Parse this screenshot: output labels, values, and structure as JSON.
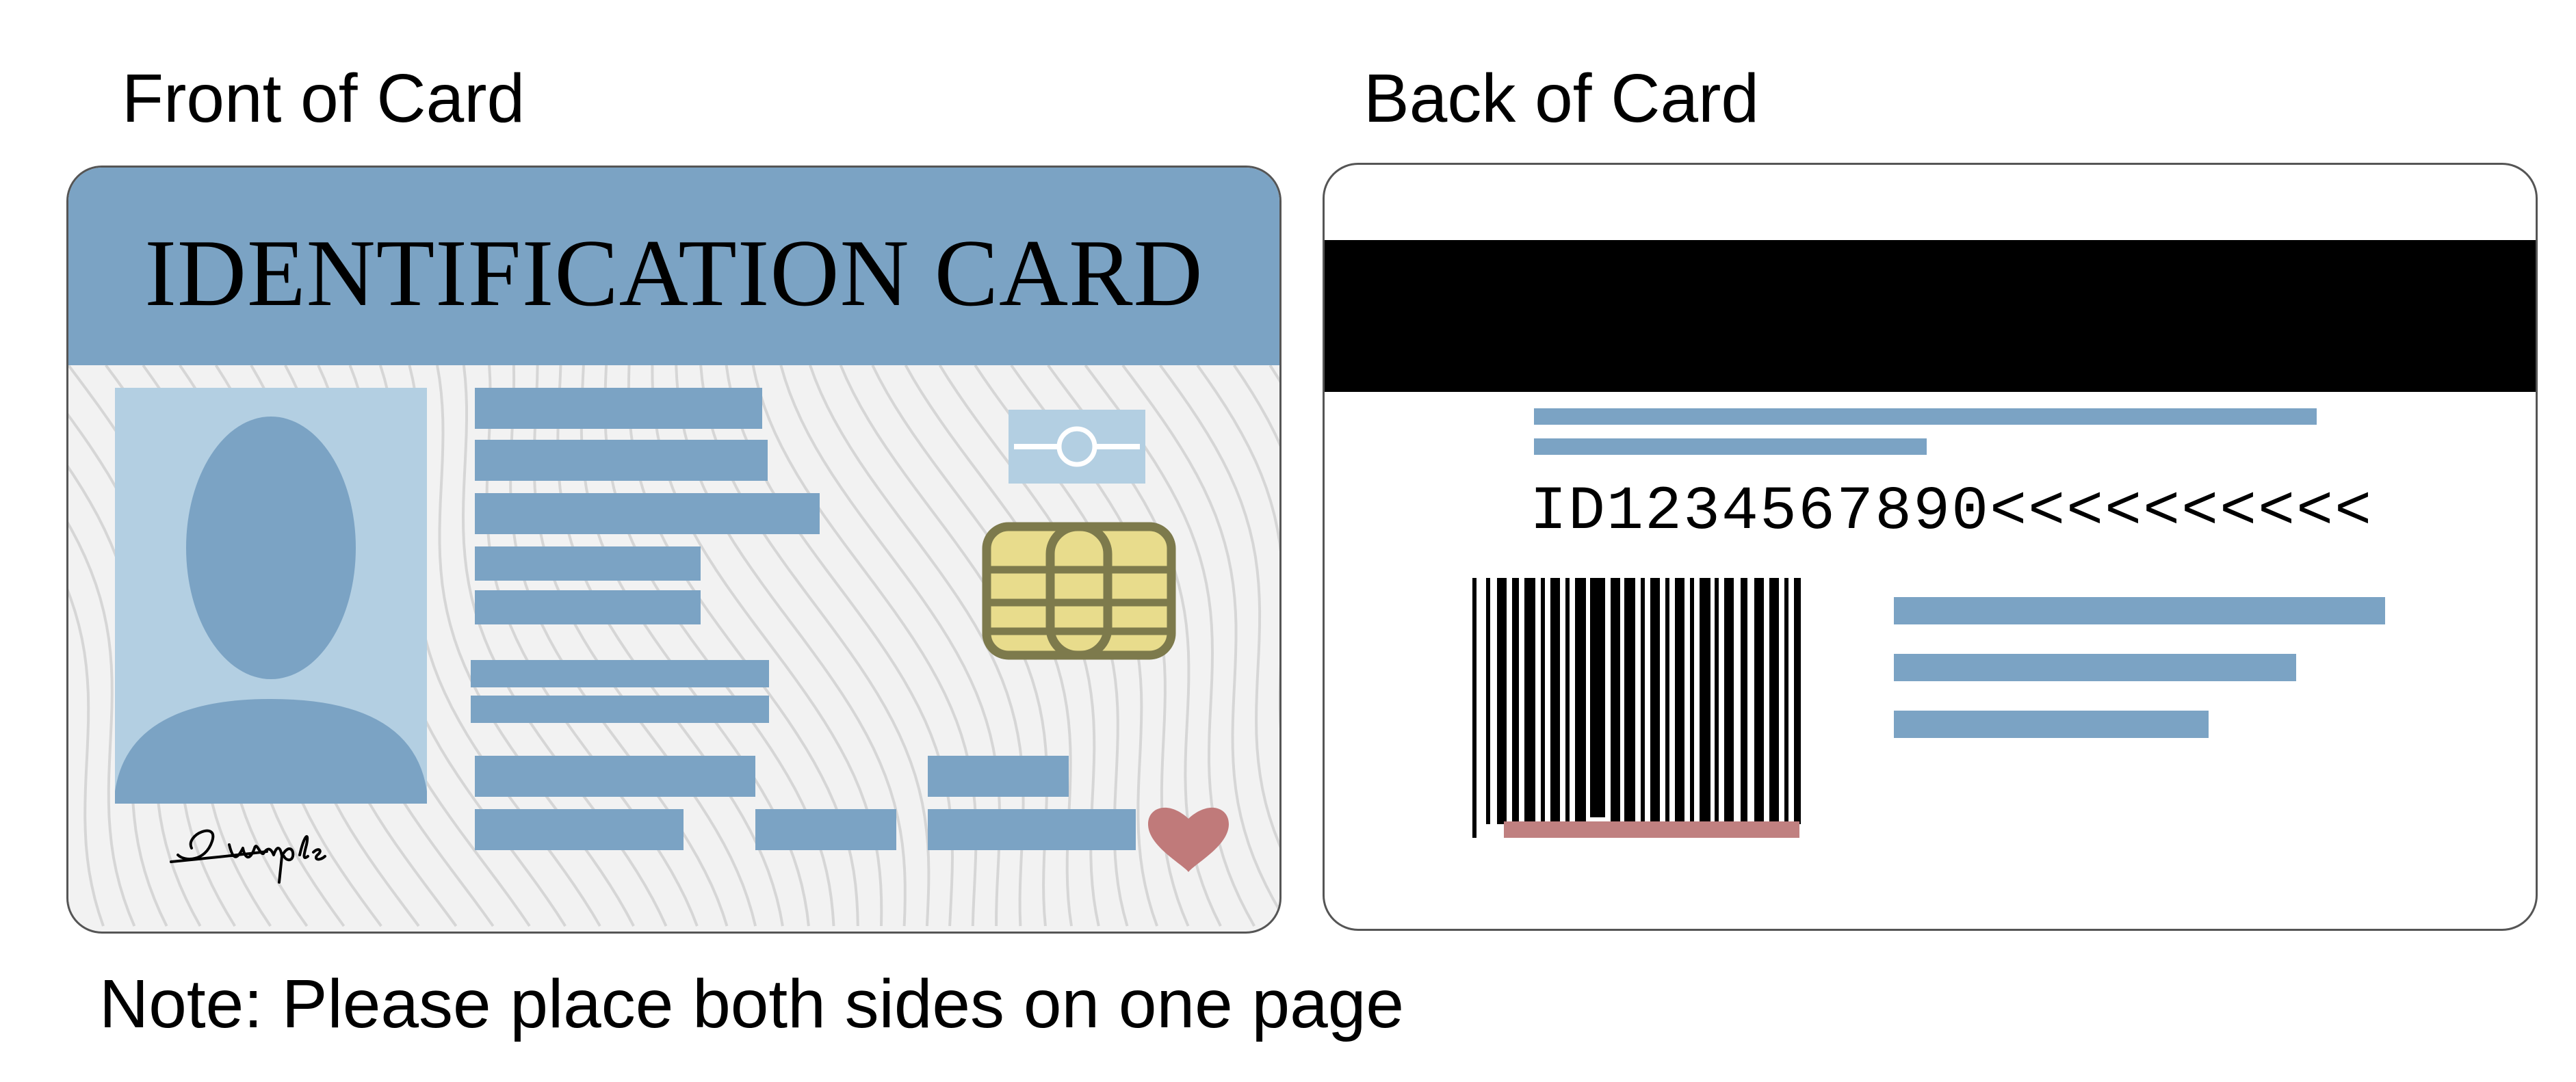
{
  "headings": {
    "front": "Front of Card",
    "back": "Back of Card",
    "note": "Note: Please place both sides on one page"
  },
  "front_card": {
    "title": "IDENTIFICATION CARD",
    "signature": "Sample",
    "icons": [
      "portrait-silhouette-icon",
      "hologram-icon",
      "chip-icon",
      "heart-icon"
    ]
  },
  "back_card": {
    "mrz_line": "ID1234567890<<<<<<<<<<",
    "icons": [
      "barcode-icon"
    ]
  },
  "colors": {
    "banner_blue": "#7ba3c4",
    "photo_background": "#b3cfe2",
    "chip_gold": "#e8dc8c",
    "chip_outline": "#7d7a4c",
    "heart_red": "#c07a7a",
    "barcode_underline": "#c08080"
  }
}
